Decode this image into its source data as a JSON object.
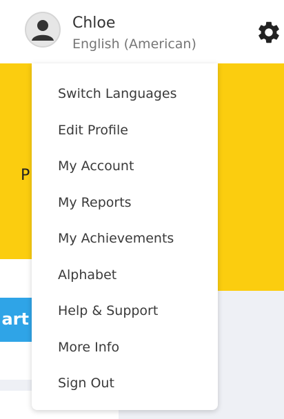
{
  "user": {
    "name": "Chloe",
    "language": "English (American)"
  },
  "background": {
    "banner_partial_text": "P",
    "start_button_partial_label": "art"
  },
  "menu": {
    "items": [
      {
        "label": "Switch Languages"
      },
      {
        "label": "Edit Profile"
      },
      {
        "label": "My Account"
      },
      {
        "label": "My Reports"
      },
      {
        "label": "My Achievements"
      },
      {
        "label": "Alphabet"
      },
      {
        "label": "Help & Support"
      },
      {
        "label": "More Info"
      },
      {
        "label": "Sign Out"
      }
    ]
  },
  "icons": {
    "avatar": "user-avatar-icon",
    "settings": "gear-icon"
  },
  "colors": {
    "banner_yellow": "#fbcd0f",
    "start_button_blue": "#2fa4e7",
    "page_gray": "#eef0f5"
  }
}
